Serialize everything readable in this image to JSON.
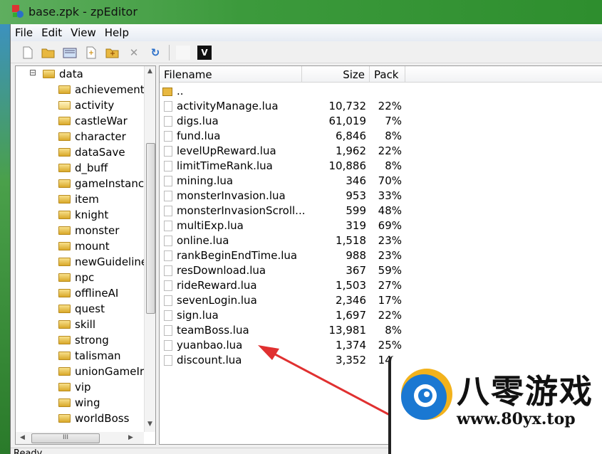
{
  "window": {
    "title": "base.zpk - zpEditor"
  },
  "menu": [
    "File",
    "Edit",
    "View",
    "Help"
  ],
  "toolbar": {
    "icons": [
      "new-file-icon",
      "open-folder-icon",
      "save-archive-icon",
      "add-file-icon",
      "add-folder-icon",
      "delete-icon",
      "refresh-icon",
      "blank-icon",
      "v-icon"
    ],
    "v_label": "V"
  },
  "tree": {
    "root": "data",
    "items": [
      "achievement",
      "activity",
      "castleWar",
      "character",
      "dataSave",
      "d_buff",
      "gameInstanc",
      "item",
      "knight",
      "monster",
      "mount",
      "newGuideline",
      "npc",
      "offlineAI",
      "quest",
      "skill",
      "strong",
      "talisman",
      "unionGameIr",
      "vip",
      "wing",
      "worldBoss"
    ],
    "selected": "activity",
    "hscroll_label": "III"
  },
  "list": {
    "columns": [
      "Filename",
      "Size",
      "Pack"
    ],
    "parent": "..",
    "rows": [
      [
        "activityManage.lua",
        "10,732",
        "22%"
      ],
      [
        "digs.lua",
        "61,019",
        "7%"
      ],
      [
        "fund.lua",
        "6,846",
        "8%"
      ],
      [
        "levelUpReward.lua",
        "1,962",
        "22%"
      ],
      [
        "limitTimeRank.lua",
        "10,886",
        "8%"
      ],
      [
        "mining.lua",
        "346",
        "70%"
      ],
      [
        "monsterInvasion.lua",
        "953",
        "33%"
      ],
      [
        "monsterInvasionScroll...",
        "599",
        "48%"
      ],
      [
        "multiExp.lua",
        "319",
        "69%"
      ],
      [
        "online.lua",
        "1,518",
        "23%"
      ],
      [
        "rankBeginEndTime.lua",
        "988",
        "23%"
      ],
      [
        "resDownload.lua",
        "367",
        "59%"
      ],
      [
        "rideReward.lua",
        "1,503",
        "27%"
      ],
      [
        "sevenLogin.lua",
        "2,346",
        "17%"
      ],
      [
        "sign.lua",
        "1,697",
        "22%"
      ],
      [
        "teamBoss.lua",
        "13,981",
        "8%"
      ],
      [
        "yuanbao.lua",
        "1,374",
        "25%"
      ],
      [
        "discount.lua",
        "3,352",
        "14%"
      ]
    ]
  },
  "status": {
    "text": "Ready"
  },
  "watermark": {
    "brand": "八零游戏",
    "url": "www.80yx.top"
  },
  "colors": {
    "title_green": "#3c9a3c",
    "arrow": "#e03030"
  }
}
